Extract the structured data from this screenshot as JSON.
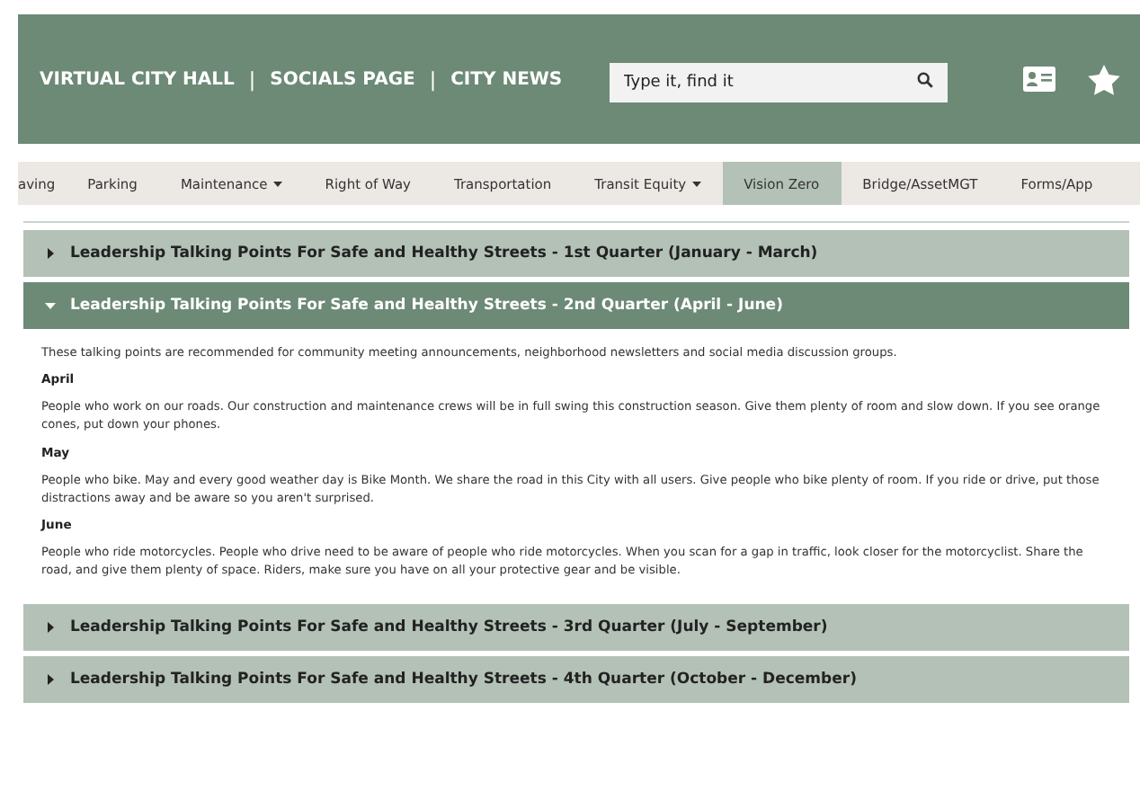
{
  "header": {
    "links": [
      "VIRTUAL CITY HALL",
      "SOCIALS PAGE",
      "CITY NEWS"
    ],
    "separators": [
      "|",
      "|"
    ],
    "search": {
      "placeholder": "Type it, find it"
    }
  },
  "nav": [
    {
      "label": "aving",
      "dropdown": false,
      "selected": false
    },
    {
      "label": "Parking",
      "dropdown": false,
      "selected": false
    },
    {
      "label": "Maintenance",
      "dropdown": true,
      "selected": false
    },
    {
      "label": "Right of Way",
      "dropdown": false,
      "selected": false
    },
    {
      "label": "Transportation",
      "dropdown": false,
      "selected": false
    },
    {
      "label": "Transit Equity",
      "dropdown": true,
      "selected": false
    },
    {
      "label": "Vision Zero",
      "dropdown": false,
      "selected": true
    },
    {
      "label": "Bridge/AssetMGT",
      "dropdown": false,
      "selected": false
    },
    {
      "label": "Forms/App",
      "dropdown": false,
      "selected": false
    }
  ],
  "accordion": [
    {
      "title": "Leadership Talking Points For Safe and Healthy Streets - 1st Quarter (January - March)",
      "expanded": false
    },
    {
      "title": "Leadership Talking Points For Safe and Healthy Streets - 2nd Quarter (April - June)",
      "expanded": true,
      "intro": "These talking points are recommended for community meeting announcements, neighborhood newsletters and social media discussion groups.",
      "sections": [
        {
          "heading": "April",
          "text": "People who work on our roads. Our construction and maintenance crews will be in full swing this construction season. Give them plenty of room and slow down. If you see orange cones, put down your phones."
        },
        {
          "heading": "May",
          "text": "People who bike. May and every good weather day is Bike Month. We share the road in this City with all users. Give people who bike plenty of room. If you ride or drive, put those distractions away and be aware so you aren't surprised."
        },
        {
          "heading": "June",
          "text": "People who ride motorcycles. People who drive need to be aware of people who ride motorcycles. When you scan for a gap in traffic, look closer for the motorcyclist. Share the road, and give them plenty of space. Riders, make sure you have on all your protective gear and be visible."
        }
      ]
    },
    {
      "title": "Leadership Talking Points For Safe and Healthy Streets - 3rd Quarter (July - September)",
      "expanded": false
    },
    {
      "title": "Leadership Talking Points For Safe and Healthy Streets - 4th Quarter (October - December)",
      "expanded": false
    }
  ]
}
